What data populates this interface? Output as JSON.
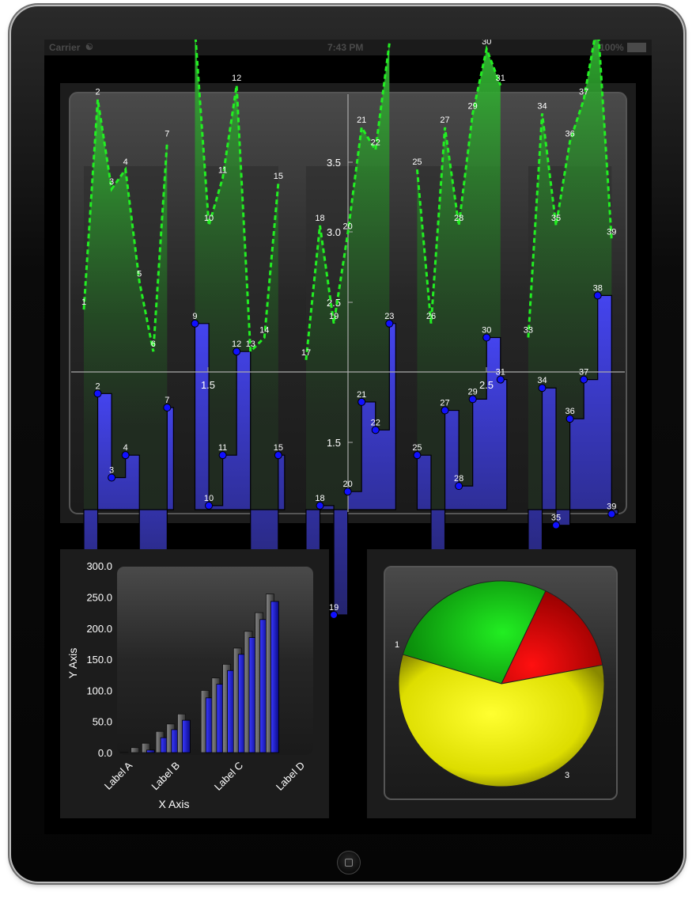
{
  "status_bar": {
    "carrier": "Carrier",
    "time": "7:43 PM",
    "battery": "100%"
  },
  "colors": {
    "green_line": "#22ee22",
    "blue_bar": "#2a2ad8",
    "pie_green": "#11cc11",
    "pie_red": "#dd0000",
    "pie_yellow": "#eeee00"
  },
  "chart_data": [
    {
      "type": "area",
      "title": "",
      "x_ticks": [
        "1.5",
        "2.5"
      ],
      "y_ticks": [
        "1.5",
        "2.5",
        "3.0",
        "3.5"
      ],
      "series": [
        {
          "style": "dashed-line",
          "labels": [
            "1",
            "2",
            "3",
            "4",
            "5",
            "6",
            "7",
            "9",
            "10",
            "11",
            "12",
            "13",
            "14",
            "15",
            "17",
            "18",
            "19",
            "20",
            "21",
            "22",
            "23",
            "25",
            "26",
            "27",
            "28",
            "29",
            "30",
            "31",
            "33",
            "34",
            "35",
            "36",
            "37",
            "38",
            "39"
          ],
          "values": [
            2.35,
            3.1,
            2.78,
            2.85,
            2.45,
            2.2,
            2.95,
            3.35,
            2.65,
            2.82,
            3.15,
            2.2,
            2.25,
            2.8,
            2.17,
            2.65,
            2.3,
            2.62,
            3.0,
            2.92,
            3.3,
            2.85,
            2.3,
            3.0,
            2.65,
            3.05,
            3.28,
            3.15,
            2.25,
            3.05,
            2.65,
            2.95,
            3.1,
            3.38,
            2.6
          ]
        },
        {
          "style": "step-bars",
          "labels": [
            "1",
            "2",
            "3",
            "4",
            "5",
            "6",
            "7",
            "9",
            "10",
            "11",
            "12",
            "13",
            "14",
            "15",
            "17",
            "18",
            "19",
            "20",
            "21",
            "22",
            "23",
            "25",
            "26",
            "27",
            "28",
            "29",
            "30",
            "31",
            "33",
            "34",
            "35",
            "36",
            "37",
            "38",
            "39"
          ],
          "values": [
            1.35,
            2.05,
            1.75,
            1.83,
            1.45,
            1.25,
            2.0,
            2.3,
            1.65,
            1.83,
            2.2,
            1.23,
            1.25,
            1.83,
            1.2,
            1.65,
            1.26,
            1.7,
            2.02,
            1.92,
            2.3,
            1.83,
            1.3,
            1.99,
            1.72,
            2.03,
            2.25,
            2.1,
            1.24,
            2.07,
            1.58,
            1.96,
            2.1,
            2.4,
            1.62
          ]
        }
      ]
    },
    {
      "type": "bar",
      "xlabel": "X Axis",
      "ylabel": "Y Axis",
      "ylim": [
        0,
        300
      ],
      "y_ticks": [
        "0.0",
        "50.0",
        "100.0",
        "150.0",
        "200.0",
        "250.0",
        "300.0"
      ],
      "x_tick_labels": [
        "Label A",
        "Label B",
        "Label C",
        "Label D"
      ],
      "series": [
        {
          "name": "",
          "values": [
            1,
            8,
            15,
            34,
            46,
            62,
            100,
            120,
            142,
            168,
            195,
            225,
            255
          ]
        },
        {
          "name": "",
          "values": [
            0,
            0,
            4,
            24,
            37,
            52,
            88,
            110,
            132,
            158,
            185,
            214,
            243
          ]
        }
      ]
    },
    {
      "type": "pie",
      "labels": [
        "1",
        "",
        "3"
      ],
      "slices": [
        {
          "label": "1",
          "value": 27.5
        },
        {
          "label": "",
          "value": 15
        },
        {
          "label": "3",
          "value": 57.5
        }
      ]
    }
  ]
}
